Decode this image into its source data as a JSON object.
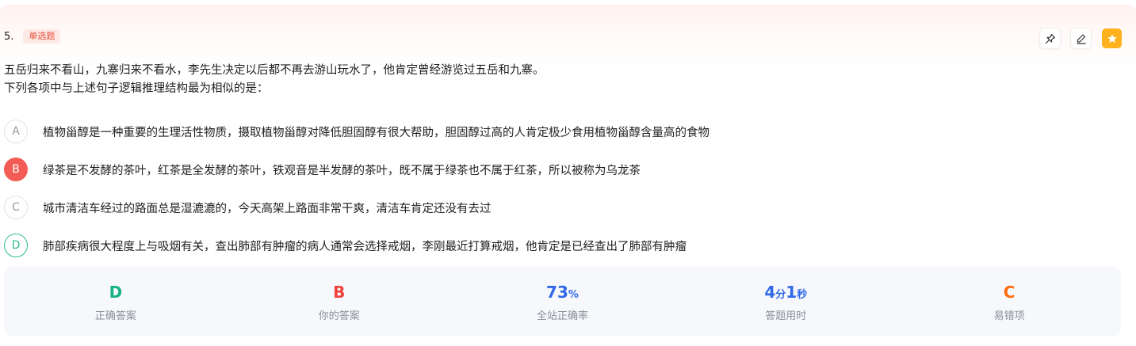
{
  "question": {
    "number": "5.",
    "type": "单选题",
    "stem_lines": [
      "五岳归来不看山，九寨归来不看水，李先生决定以后都不再去游山玩水了，他肯定曾经游览过五岳和九寨。",
      "下列各项中与上述句子逻辑推理结构最为相似的是："
    ]
  },
  "tools": {
    "pin": "pin-icon",
    "edit": "pencil-icon",
    "favorite": "star-icon"
  },
  "options": [
    {
      "letter": "A",
      "text": "植物甾醇是一种重要的生理活性物质，摄取植物甾醇对降低胆固醇有很大帮助，胆固醇过高的人肯定极少食用植物甾醇含量高的食物",
      "state": "normal"
    },
    {
      "letter": "B",
      "text": "绿茶是不发酵的茶叶，红茶是全发酵的茶叶，铁观音是半发酵的茶叶，既不属于绿茶也不属于红茶，所以被称为乌龙茶",
      "state": "wrong"
    },
    {
      "letter": "C",
      "text": "城市清洁车经过的路面总是湿漉漉的，今天高架上路面非常干爽，清洁车肯定还没有去过",
      "state": "normal"
    },
    {
      "letter": "D",
      "text": "肺部疾病很大程度上与吸烟有关，查出肺部有肿瘤的病人通常会选择戒烟，李刚最近打算戒烟，他肯定是已经查出了肺部有肿瘤",
      "state": "correct"
    }
  ],
  "stats": {
    "correct_answer": {
      "value": "D",
      "label": "正确答案"
    },
    "your_answer": {
      "value": "B",
      "label": "你的答案"
    },
    "accuracy": {
      "value": "73",
      "unit": "%",
      "label": "全站正确率"
    },
    "time": {
      "min": "4",
      "min_unit": "分",
      "sec": "1",
      "sec_unit": "秒",
      "label": "答题用时"
    },
    "easy_wrong": {
      "value": "C",
      "label": "易错项"
    }
  },
  "colors": {
    "correct": "#17b27f",
    "wrong": "#f0423c",
    "accent_blue": "#3068e8",
    "easy_wrong": "#ff6b0f",
    "favorite": "#ffb21e",
    "badge_text": "#e8503a"
  }
}
